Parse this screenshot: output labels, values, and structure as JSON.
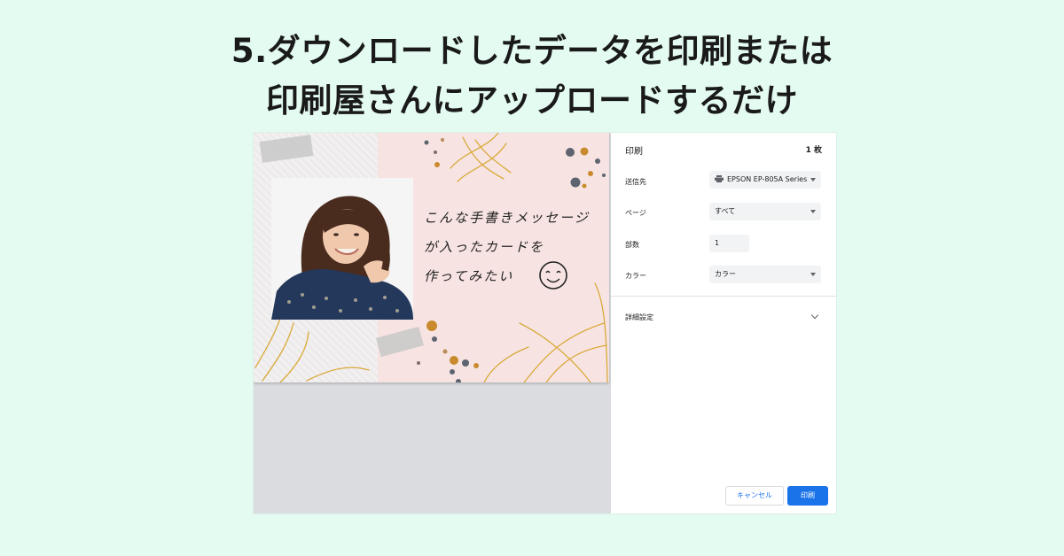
{
  "headline": {
    "line1": "5.ダウンロードしたデータを印刷または",
    "line2": "印刷屋さんにアップロードするだけ"
  },
  "card": {
    "message_line1": "こんな手書きメッセージ",
    "message_line2": "が入ったカードを",
    "message_line3": "作ってみたい"
  },
  "print_dialog": {
    "title": "印刷",
    "sheet_count": "1 枚",
    "destination": {
      "label": "送信先",
      "value": "EPSON EP-805A Series",
      "icon": "printer-icon"
    },
    "pages": {
      "label": "ページ",
      "value": "すべて"
    },
    "copies": {
      "label": "部数",
      "value": "1"
    },
    "color": {
      "label": "カラー",
      "value": "カラー"
    },
    "more_settings": {
      "label": "詳細設定"
    },
    "cancel_label": "キャンセル",
    "print_label": "印刷",
    "accent_color": "#1a73e8"
  },
  "colors": {
    "background": "#e4fbf1",
    "card_background": "#f7e4e2",
    "preview_background": "#dadce0"
  }
}
